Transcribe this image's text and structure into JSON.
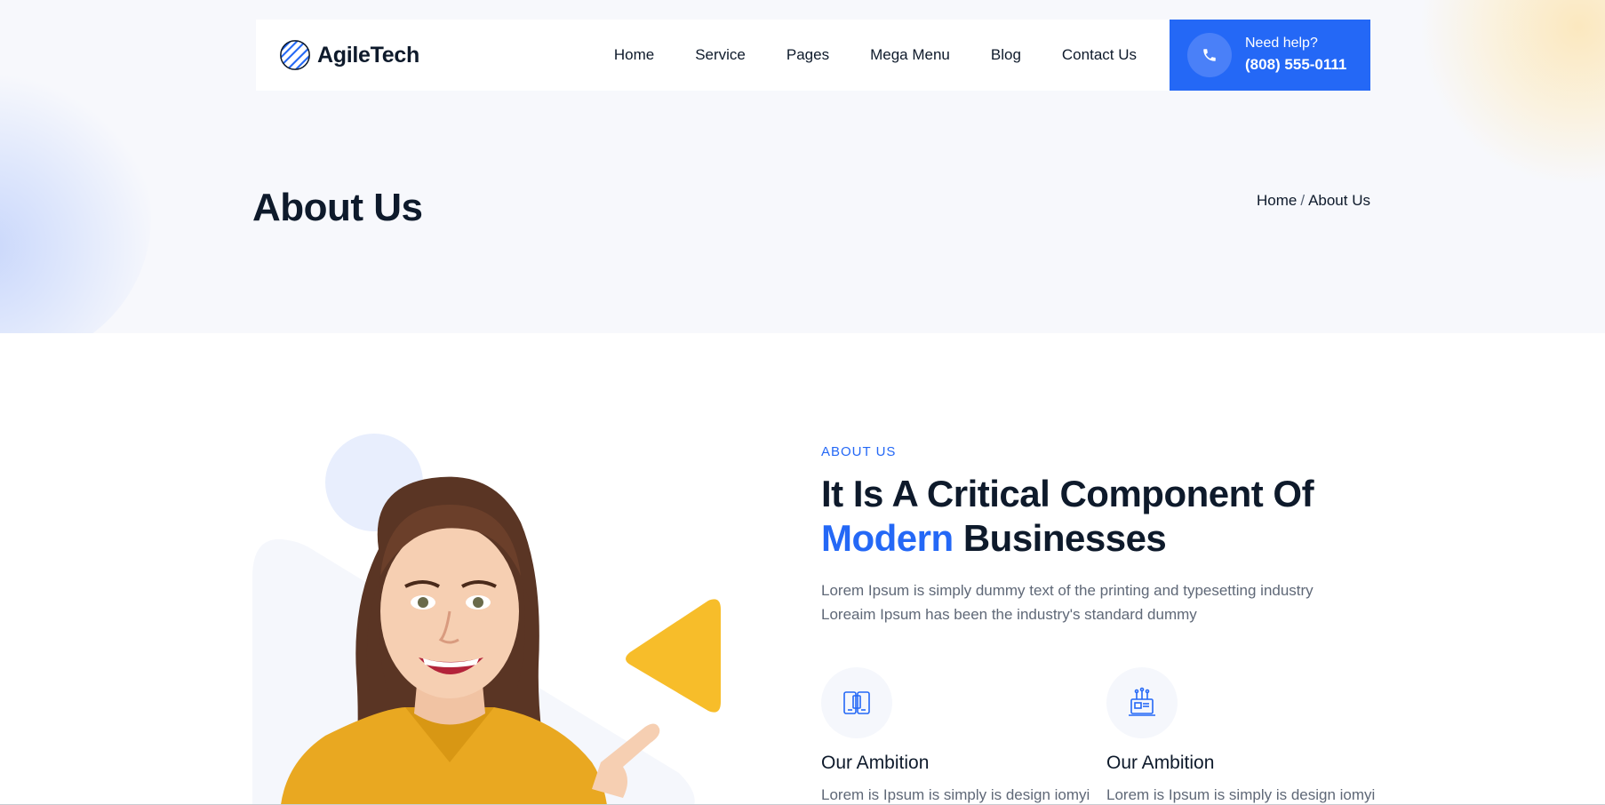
{
  "brand": {
    "name": "AgileTech",
    "accent_color": "#2468f6",
    "highlight_color": "#f7bd2a"
  },
  "nav": {
    "items": [
      {
        "label": "Home"
      },
      {
        "label": "Service"
      },
      {
        "label": "Pages"
      },
      {
        "label": "Mega Menu"
      },
      {
        "label": "Blog"
      },
      {
        "label": "Contact Us"
      }
    ]
  },
  "help": {
    "label": "Need help?",
    "phone": "(808) 555-0111",
    "icon": "phone-icon"
  },
  "hero": {
    "title": "About Us",
    "breadcrumb": {
      "home": "Home",
      "separator": "/",
      "current": "About Us"
    }
  },
  "about": {
    "eyebrow": "ABOUT US",
    "headline_line1": "It Is A Critical Component Of",
    "headline_accent": "Modern",
    "headline_rest": "Businesses",
    "lead_line1": "Lorem Ipsum is simply dummy text of the printing and typesetting industry",
    "lead_line2": "Loreaim Ipsum has been the industry's standard dummy",
    "features": [
      {
        "icon": "devices-icon",
        "title": "Our Ambition",
        "desc": "Lorem is Ipsum is simply is design iomyi"
      },
      {
        "icon": "laptop-chip-icon",
        "title": "Our Ambition",
        "desc": "Lorem is Ipsum is simply is design iomyi"
      }
    ]
  }
}
